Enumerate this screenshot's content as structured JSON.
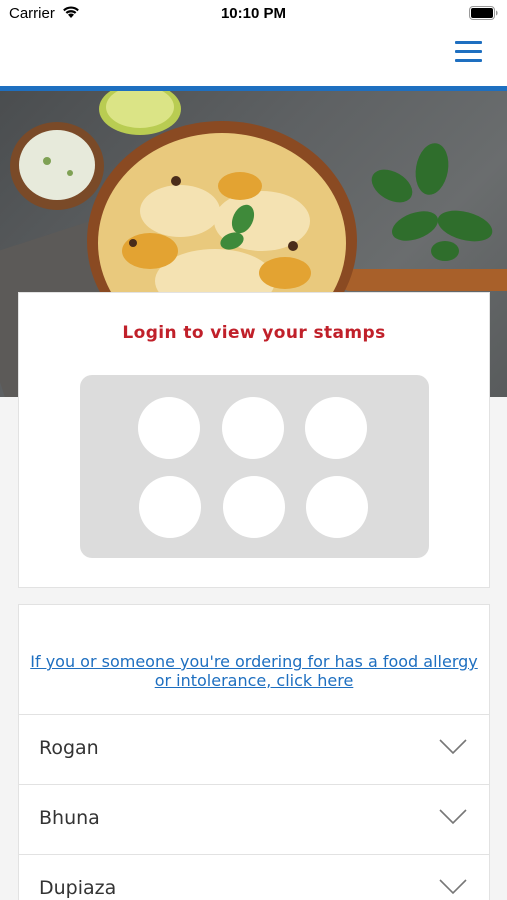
{
  "status_bar": {
    "carrier": "Carrier",
    "time": "10:10 PM"
  },
  "nav": {
    "menu_icon": "hamburger-menu-icon",
    "accent_color": "#1e6fc0"
  },
  "hero": {
    "image": "biryani-dish-photo"
  },
  "stamp_card": {
    "title": "Login to view your stamps",
    "title_color": "#c0202a",
    "stamp_count": 6
  },
  "menu": {
    "allergy_link": "If you or someone you're ordering for has a food allergy or intolerance, click here",
    "items": [
      {
        "label": "Rogan"
      },
      {
        "label": "Bhuna"
      },
      {
        "label": "Dupiaza"
      }
    ]
  }
}
